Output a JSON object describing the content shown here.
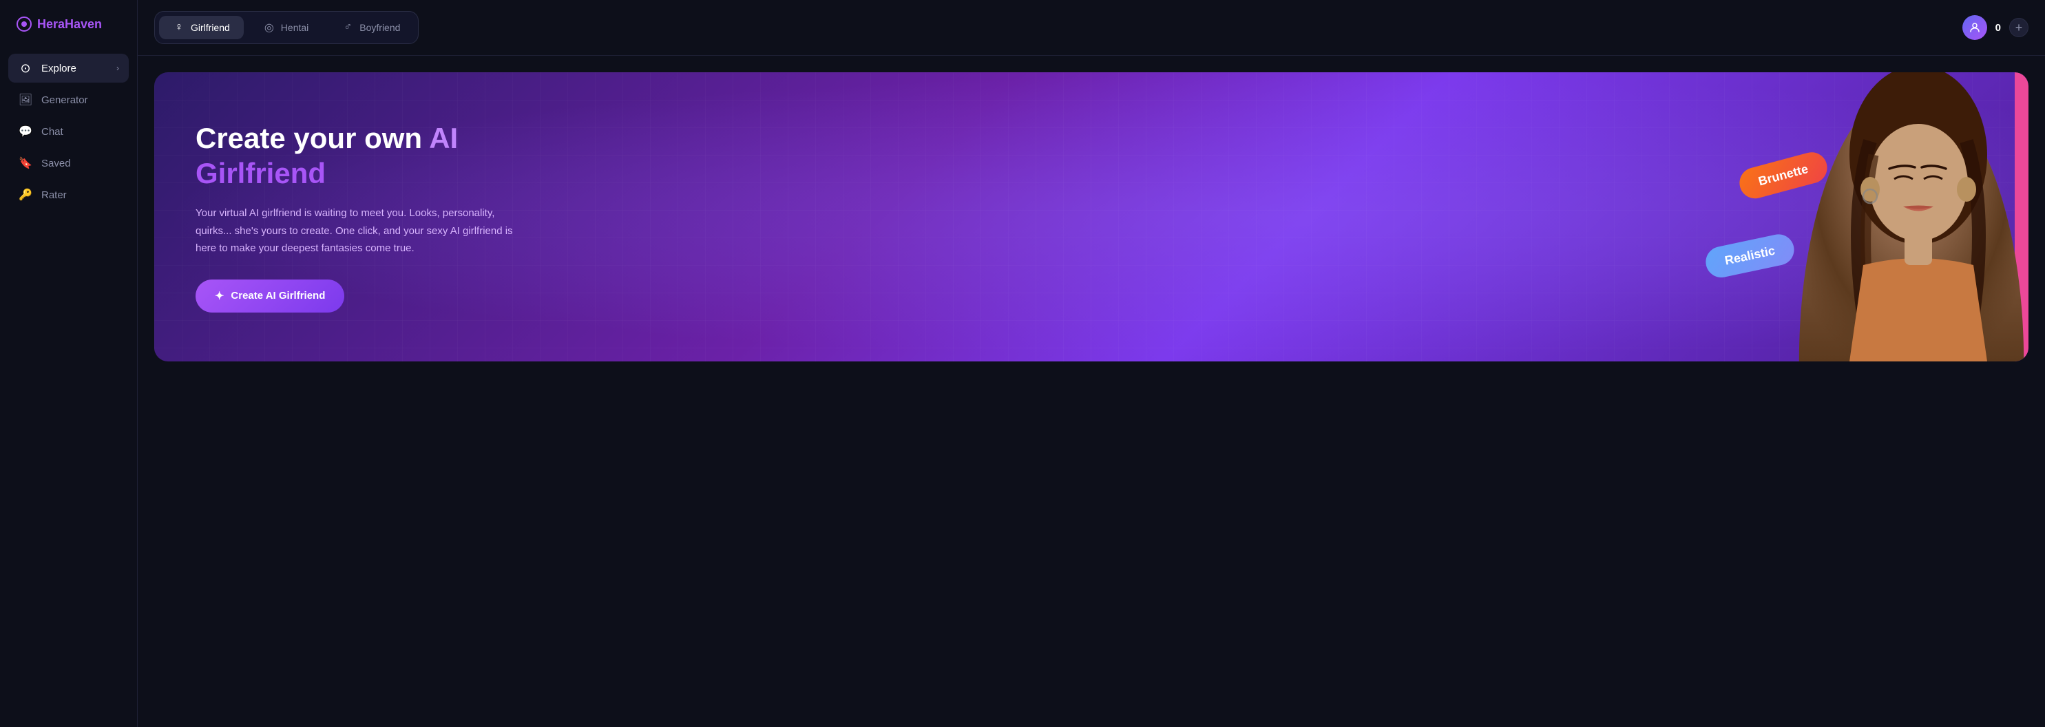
{
  "app": {
    "name": "HeraHaven",
    "logo_symbol": "○"
  },
  "sidebar": {
    "items": [
      {
        "id": "explore",
        "label": "Explore",
        "icon": "explore-icon",
        "active": true,
        "has_chevron": true
      },
      {
        "id": "generator",
        "label": "Generator",
        "icon": "generator-icon",
        "active": false,
        "has_chevron": false
      },
      {
        "id": "chat",
        "label": "Chat",
        "icon": "chat-icon",
        "active": false,
        "has_chevron": false
      },
      {
        "id": "saved",
        "label": "Saved",
        "icon": "saved-icon",
        "active": false,
        "has_chevron": false
      },
      {
        "id": "rater",
        "label": "Rater",
        "icon": "rater-icon",
        "active": false,
        "has_chevron": false
      }
    ]
  },
  "tabs": [
    {
      "id": "girlfriend",
      "label": "Girlfriend",
      "icon": "female-icon",
      "active": true
    },
    {
      "id": "hentai",
      "label": "Hentai",
      "icon": "hentai-icon",
      "active": false
    },
    {
      "id": "boyfriend",
      "label": "Boyfriend",
      "icon": "male-icon",
      "active": false
    }
  ],
  "topbar": {
    "token_count": "0",
    "add_label": "+"
  },
  "hero": {
    "title_part1": "Create your own ",
    "title_highlight": "AI",
    "title_part2": "Girlfriend",
    "description": "Your virtual AI girlfriend is waiting to meet you. Looks, personality, quirks... she's yours to create. One click, and your sexy AI girlfriend is here to make your deepest fantasies come true.",
    "cta_label": "Create AI Girlfriend",
    "tag1": "Brunette",
    "tag2": "Realistic"
  },
  "colors": {
    "accent": "#a855f7",
    "bg_dark": "#0d0f1a",
    "bg_card": "#13152a",
    "tag_brunette_start": "#f97316",
    "tag_brunette_end": "#ef4444",
    "tag_realistic_start": "#60a5fa",
    "tag_realistic_end": "#818cf8"
  }
}
